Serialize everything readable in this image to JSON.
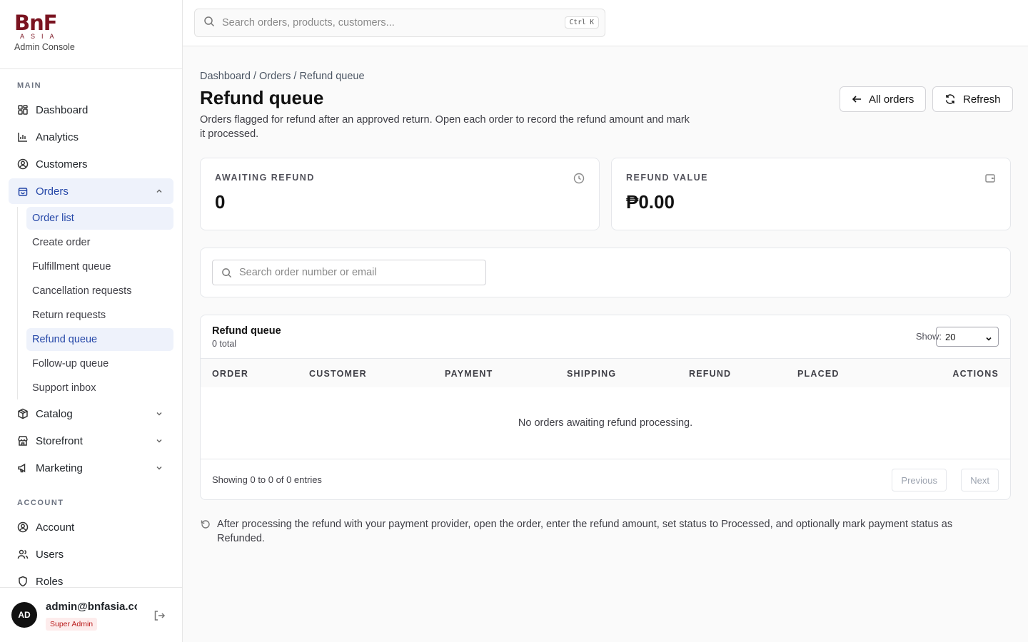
{
  "brand": {
    "logo": "BnF",
    "logo_sub": "ASIA",
    "subtitle": "Admin Console"
  },
  "sidebar": {
    "main_section": "MAIN",
    "items": [
      {
        "label": "Dashboard",
        "icon": "grid-icon"
      },
      {
        "label": "Analytics",
        "icon": "bar-chart-icon"
      },
      {
        "label": "Customers",
        "icon": "user-circle-icon"
      },
      {
        "label": "Orders",
        "icon": "shopping-bag-icon",
        "expanded": true,
        "active": true
      },
      {
        "label": "Catalog",
        "icon": "package-icon"
      },
      {
        "label": "Storefront",
        "icon": "store-icon"
      },
      {
        "label": "Marketing",
        "icon": "megaphone-icon"
      }
    ],
    "orders_sub": [
      {
        "label": "Order list",
        "active": true
      },
      {
        "label": "Create order"
      },
      {
        "label": "Fulfillment queue"
      },
      {
        "label": "Cancellation requests"
      },
      {
        "label": "Return requests"
      },
      {
        "label": "Refund queue",
        "active": true
      },
      {
        "label": "Follow-up queue"
      },
      {
        "label": "Support inbox"
      }
    ],
    "account_section": "ACCOUNT",
    "account_items": [
      {
        "label": "Account",
        "icon": "user-circle-icon"
      },
      {
        "label": "Users",
        "icon": "users-icon"
      },
      {
        "label": "Roles",
        "icon": "shield-icon"
      }
    ]
  },
  "user": {
    "initials": "AD",
    "email": "admin@bnfasia.com",
    "role": "Super Admin"
  },
  "topbar": {
    "search_placeholder": "Search orders, products, customers...",
    "shortcut": "Ctrl K"
  },
  "page": {
    "breadcrumb": [
      "Dashboard",
      "Orders",
      "Refund queue"
    ],
    "title": "Refund queue",
    "description": "Orders flagged for refund after an approved return. Open each order to record the refund amount and mark it processed.",
    "buttons": {
      "all_orders": "All orders",
      "refresh": "Refresh"
    }
  },
  "stats": [
    {
      "label": "AWAITING REFUND",
      "value": "0",
      "icon": "clock-icon"
    },
    {
      "label": "REFUND VALUE",
      "value": "₱0.00",
      "icon": "wallet-icon"
    }
  ],
  "filter": {
    "placeholder": "Search order number or email"
  },
  "table": {
    "title": "Refund queue",
    "total": "0 total",
    "show_label": "Show:",
    "page_size": "20",
    "columns": [
      "ORDER",
      "CUSTOMER",
      "PAYMENT",
      "SHIPPING",
      "REFUND",
      "PLACED",
      "ACTIONS"
    ],
    "empty_text": "No orders awaiting refund processing.",
    "footer_text": "Showing 0 to 0 of 0 entries",
    "prev": "Previous",
    "next": "Next"
  },
  "note": "After processing the refund with your payment provider, open the order, enter the refund amount, set status to Processed, and optionally mark payment status as Refunded."
}
